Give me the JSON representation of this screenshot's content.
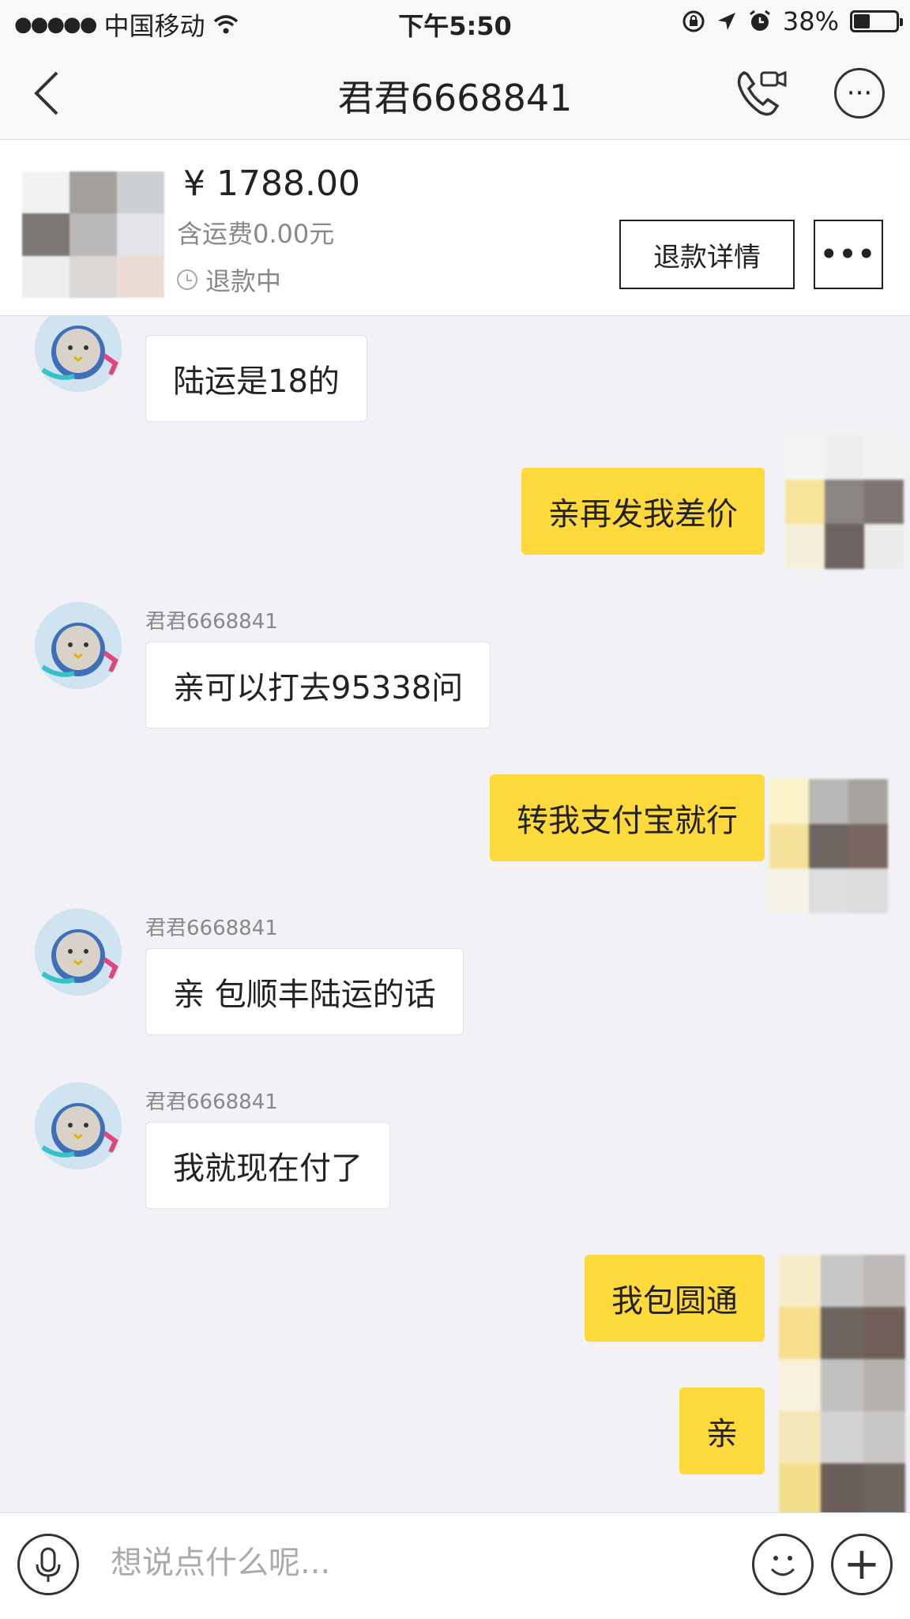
{
  "status_bar": {
    "signal_dots": "●●●●●",
    "carrier": "中国移动",
    "time": "下午5:50",
    "battery_text": "38%",
    "battery_level": 0.38
  },
  "nav": {
    "title": "君君6668841",
    "more_glyph": "···"
  },
  "order": {
    "price": "¥ 1788.00",
    "shipping": "含运费0.00元",
    "status": "退款中",
    "refund_button": "退款详情",
    "more_button": "•••"
  },
  "messages": [
    {
      "side": "in",
      "sender": "",
      "text": "陆运是18的"
    },
    {
      "side": "out",
      "text": "亲再发我差价"
    },
    {
      "side": "in",
      "sender": "君君6668841",
      "text": "亲可以打去95338问"
    },
    {
      "side": "out",
      "text": "转我支付宝就行"
    },
    {
      "side": "in",
      "sender": "君君6668841",
      "text": "亲  包顺丰陆运的话"
    },
    {
      "side": "in",
      "sender": "君君6668841",
      "text": "我就现在付了"
    },
    {
      "side": "out",
      "text": "我包圆通"
    },
    {
      "side": "out",
      "text": "亲"
    }
  ],
  "input": {
    "placeholder": "想说点什么呢...",
    "plus_glyph": "+"
  },
  "colors": {
    "outgoing_bubble": "#fdd93c",
    "incoming_bubble": "#ffffff",
    "background": "#f2f2f6"
  }
}
